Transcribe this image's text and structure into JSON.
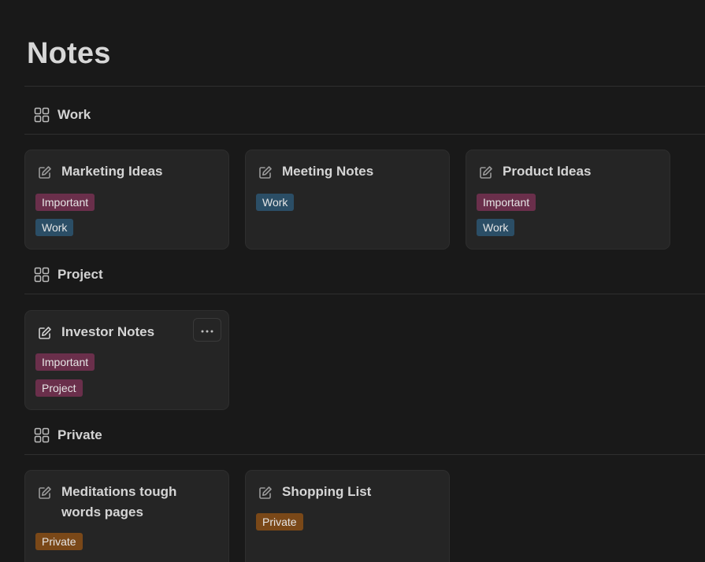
{
  "page": {
    "title": "Notes"
  },
  "groups": [
    {
      "label": "Work",
      "icon": "gallery-view-icon",
      "cards": [
        {
          "title": "Marketing Ideas",
          "icon": "edit-note-icon",
          "tags": [
            "Important",
            "Work"
          ]
        },
        {
          "title": "Meeting Notes",
          "icon": "edit-note-icon",
          "tags": [
            "Work"
          ]
        },
        {
          "title": "Product Ideas",
          "icon": "edit-note-icon",
          "tags": [
            "Important",
            "Work"
          ]
        }
      ]
    },
    {
      "label": "Project",
      "icon": "gallery-view-icon",
      "cards": [
        {
          "title": "Investor Notes",
          "icon": "edit-note-icon",
          "tags": [
            "Important",
            "Project"
          ],
          "more_label": "More actions"
        }
      ]
    },
    {
      "label": "Private",
      "icon": "gallery-view-icon",
      "cards": [
        {
          "title": "Meditations tough words pages",
          "icon": "edit-note-icon",
          "tags": [
            "Private"
          ]
        },
        {
          "title": "Shopping List",
          "icon": "edit-note-icon",
          "tags": [
            "Private"
          ]
        }
      ]
    }
  ],
  "colors": {
    "background": "#191919",
    "card": "#252525",
    "tag_important": "#6a2f4b",
    "tag_work": "#2b4e66",
    "tag_project": "#6a2f4b",
    "tag_private": "#7a4818"
  }
}
